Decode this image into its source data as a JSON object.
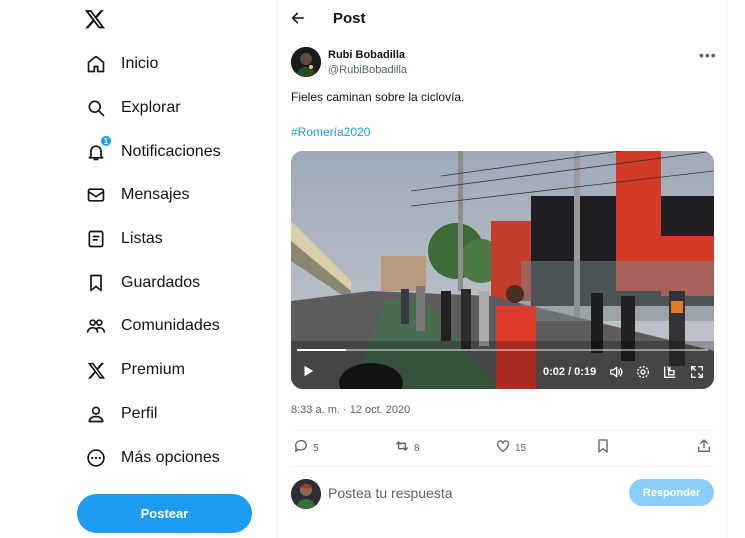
{
  "sidebar": {
    "logo_icon": "x-logo-icon",
    "items": [
      {
        "label": "Inicio",
        "icon": "home-icon"
      },
      {
        "label": "Explorar",
        "icon": "search-icon"
      },
      {
        "label": "Notificaciones",
        "icon": "bell-icon",
        "badge": "1"
      },
      {
        "label": "Mensajes",
        "icon": "mail-icon"
      },
      {
        "label": "Listas",
        "icon": "list-icon"
      },
      {
        "label": "Guardados",
        "icon": "bookmark-icon"
      },
      {
        "label": "Comunidades",
        "icon": "communities-icon"
      },
      {
        "label": "Premium",
        "icon": "x-premium-icon"
      },
      {
        "label": "Perfil",
        "icon": "person-icon"
      },
      {
        "label": "Más opciones",
        "icon": "more-circle-icon"
      }
    ],
    "post_button": "Postear"
  },
  "header": {
    "title": "Post"
  },
  "tweet": {
    "author_name": "Rubi Bobadilla",
    "author_handle": "@RubiBobadilla",
    "text": "Fieles caminan sobre la ciclovía.",
    "hashtag": "#Romería2020",
    "video": {
      "time": "0:02 / 0:19",
      "progress": 0.12
    },
    "timestamp": "8:33 a. m. · 12 oct. 2020",
    "actions": {
      "replies": "5",
      "reposts": "8",
      "likes": "15"
    }
  },
  "reply": {
    "placeholder": "Postea tu respuesta",
    "button": "Responder"
  },
  "colors": {
    "accent": "#1d9bf0",
    "reply_button": "#8ecdf8",
    "text_secondary": "#536471"
  }
}
